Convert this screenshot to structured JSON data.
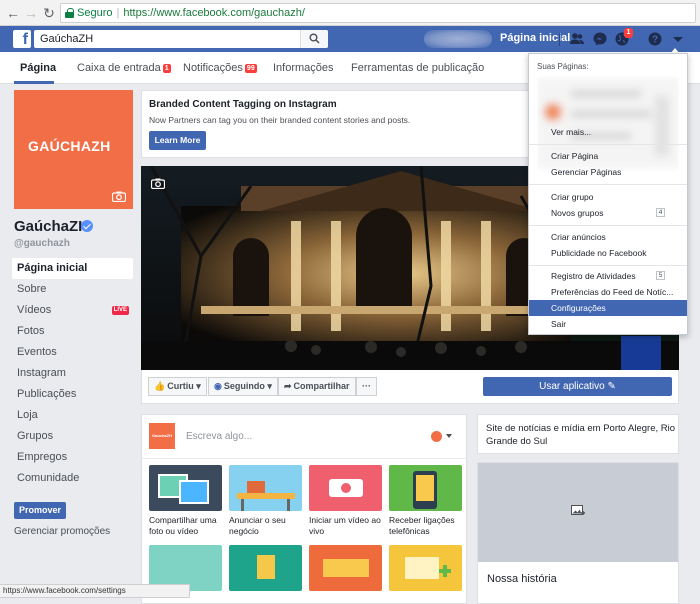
{
  "browser": {
    "secure_label": "Seguro",
    "url": "https://www.facebook.com/gauchazh/",
    "status_url": "https://www.facebook.com/settings"
  },
  "topbar": {
    "search_value": "GaúchaZH",
    "home_label": "Página inicial",
    "notification_count": "1"
  },
  "tabs": [
    {
      "label": "Página",
      "badge": ""
    },
    {
      "label": "Caixa de entrada",
      "badge": "1"
    },
    {
      "label": "Notificações",
      "badge": "99"
    },
    {
      "label": "Informações",
      "badge": ""
    },
    {
      "label": "Ferramentas de publicação",
      "badge": ""
    }
  ],
  "page": {
    "logo_text": "GAÚCHAZH",
    "name": "GaúchaZH",
    "handle": "@gauchazh"
  },
  "left_nav": [
    {
      "label": "Página inicial"
    },
    {
      "label": "Sobre"
    },
    {
      "label": "Vídeos",
      "badge": "LIVE"
    },
    {
      "label": "Fotos"
    },
    {
      "label": "Eventos"
    },
    {
      "label": "Instagram"
    },
    {
      "label": "Publicações"
    },
    {
      "label": "Loja"
    },
    {
      "label": "Grupos"
    },
    {
      "label": "Empregos"
    },
    {
      "label": "Comunidade"
    }
  ],
  "promote": {
    "button_label": "Promover",
    "manage_label": "Gerenciar promoções"
  },
  "banner": {
    "title": "Branded Content Tagging on Instagram",
    "text": "Now Partners can tag you on their branded content stories and posts.",
    "button": "Learn More"
  },
  "actions": {
    "like": "Curtiu",
    "follow": "Seguindo",
    "share": "Compartilhar",
    "more": "···",
    "use_app": "Usar aplicativo"
  },
  "composer": {
    "avatar_text": "GaúchaZH",
    "placeholder": "Escreva algo...",
    "cards": [
      {
        "label": "Compartilhar uma foto ou vídeo"
      },
      {
        "label": "Anunciar o seu negócio"
      },
      {
        "label": "Iniciar um vídeo ao vivo"
      },
      {
        "label": "Receber ligações telefônicas"
      }
    ]
  },
  "about": {
    "text": "Site de notícias e mídia em Porto Alegre, Rio Grande do Sul"
  },
  "story": {
    "title": "Nossa história"
  },
  "dropdown": {
    "header": "Suas Páginas:",
    "items": [
      {
        "label": "Ver mais..."
      },
      {
        "label": "Criar Página"
      },
      {
        "label": "Gerenciar Páginas"
      },
      {
        "label": "Criar grupo"
      },
      {
        "label": "Novos grupos",
        "count": "4"
      },
      {
        "label": "Criar anúncios"
      },
      {
        "label": "Publicidade no Facebook"
      },
      {
        "label": "Registro de Atividades",
        "count": "5"
      },
      {
        "label": "Preferências do Feed de Notíc..."
      },
      {
        "label": "Configurações",
        "highlighted": true
      },
      {
        "label": "Sair"
      }
    ]
  },
  "colors": {
    "facebook_blue": "#4267b2",
    "brand_orange": "#f16e47",
    "badge_red": "#fa3e3e",
    "page_bg": "#e9ebee"
  }
}
